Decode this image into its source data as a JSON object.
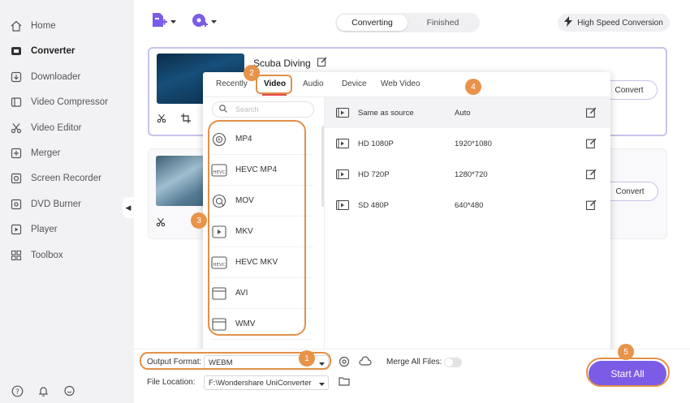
{
  "sidebar": {
    "items": [
      {
        "label": "Home",
        "icon": "home-icon"
      },
      {
        "label": "Converter",
        "icon": "converter-icon",
        "active": true
      },
      {
        "label": "Downloader",
        "icon": "downloader-icon"
      },
      {
        "label": "Video Compressor",
        "icon": "compressor-icon"
      },
      {
        "label": "Video Editor",
        "icon": "scissors-icon"
      },
      {
        "label": "Merger",
        "icon": "merger-icon"
      },
      {
        "label": "Screen Recorder",
        "icon": "screen-recorder-icon"
      },
      {
        "label": "DVD Burner",
        "icon": "disc-icon"
      },
      {
        "label": "Player",
        "icon": "player-icon"
      },
      {
        "label": "Toolbox",
        "icon": "toolbox-icon"
      }
    ],
    "bottom_icons": [
      "help-icon",
      "bell-icon",
      "feedback-icon"
    ]
  },
  "toolbar": {
    "segment": {
      "converting": "Converting",
      "finished": "Finished",
      "selected": "Converting"
    },
    "high_speed": "High Speed Conversion"
  },
  "files": [
    {
      "title": "Scuba Diving",
      "convert_label": "Convert"
    },
    {
      "title": "",
      "convert_label": "Convert"
    }
  ],
  "format_panel": {
    "tabs": [
      "Recently",
      "Video",
      "Audio",
      "Device",
      "Web Video"
    ],
    "active_tab": "Video",
    "search_placeholder": "Search",
    "formats": [
      "MP4",
      "HEVC MP4",
      "MOV",
      "MKV",
      "HEVC MKV",
      "AVI",
      "WMV"
    ],
    "qualities": [
      {
        "name": "Same as source",
        "resolution": "Auto"
      },
      {
        "name": "HD 1080P",
        "resolution": "1920*1080"
      },
      {
        "name": "HD 720P",
        "resolution": "1280*720"
      },
      {
        "name": "SD 480P",
        "resolution": "640*480"
      }
    ]
  },
  "bottom_bar": {
    "output_format_label": "Output Format:",
    "output_format_value": "WEBM",
    "merge_label": "Merge All Files:",
    "file_location_label": "File Location:",
    "file_location_value": "F:\\Wondershare UniConverter",
    "start_all": "Start All"
  },
  "callouts": [
    "1",
    "2",
    "3",
    "4",
    "5"
  ],
  "colors": {
    "accent": "#7b5ce6",
    "callout": "#e8934a",
    "tab_underline": "#e5484d"
  }
}
